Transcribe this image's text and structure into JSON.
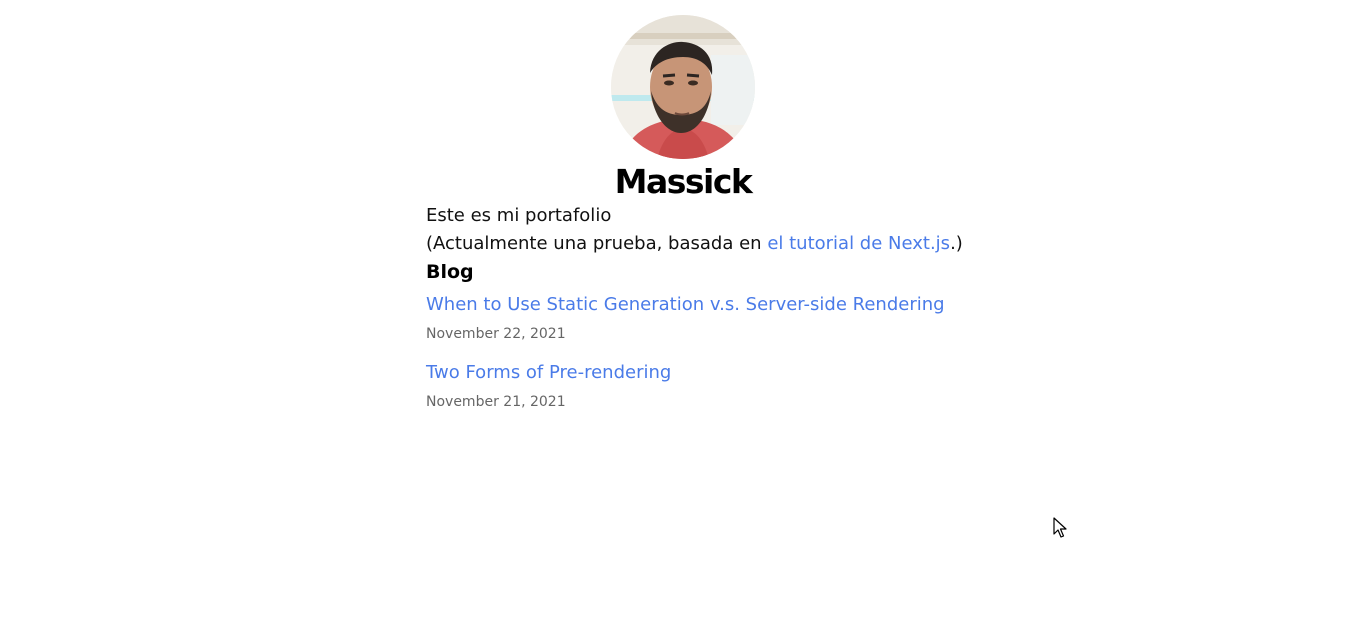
{
  "header": {
    "name": "Massick",
    "avatar_icon": "profile-photo"
  },
  "intro": {
    "line1": "Este es mi portafolio",
    "line2_prefix": "(Actualmente una prueba, basada en ",
    "line2_link": "el tutorial de Next.js",
    "line2_suffix": ".)"
  },
  "blog": {
    "title": "Blog",
    "posts": [
      {
        "title": "When to Use Static Generation v.s. Server-side Rendering",
        "date": "November 22, 2021"
      },
      {
        "title": "Two Forms of Pre-rendering",
        "date": "November 21, 2021"
      }
    ]
  },
  "colors": {
    "link": "#4a7be8",
    "date": "#666666",
    "text": "#111111"
  },
  "cursor_icon": "mouse-pointer-icon"
}
